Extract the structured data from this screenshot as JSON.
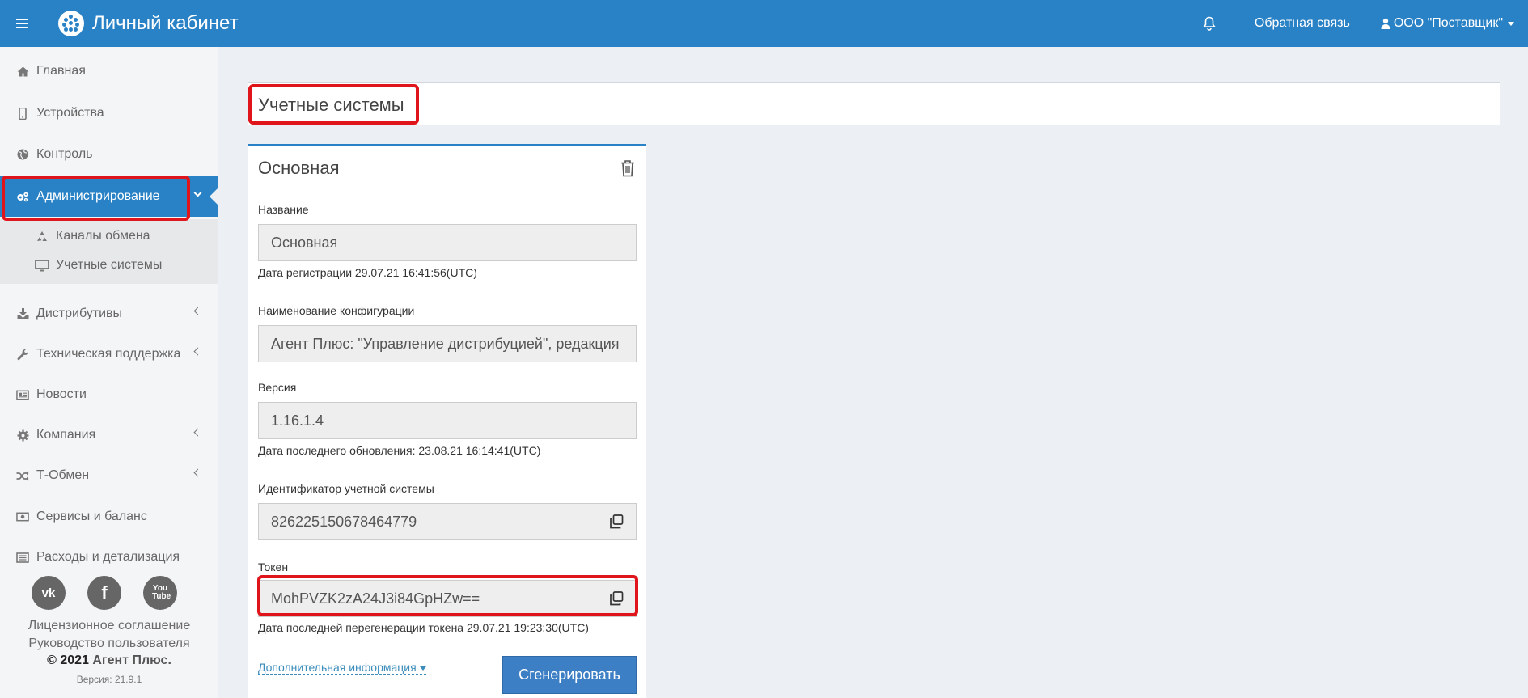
{
  "header": {
    "app_title": "Личный кабинет",
    "feedback": "Обратная связь",
    "user": "ООО \"Поставщик\"",
    "bell_icon": "bell-icon",
    "menu_icon": "hamburger-icon",
    "user_icon": "user-icon"
  },
  "sidebar": {
    "items": [
      {
        "label": "Главная",
        "icon": "home-icon"
      },
      {
        "label": "Устройства",
        "icon": "mobile-icon"
      },
      {
        "label": "Контроль",
        "icon": "globe-icon"
      },
      {
        "label": "Администрирование",
        "icon": "cogs-icon"
      },
      {
        "label": "Дистрибутивы",
        "icon": "download-icon"
      },
      {
        "label": "Техническая поддержка",
        "icon": "wrench-icon"
      },
      {
        "label": "Новости",
        "icon": "newspaper-icon"
      },
      {
        "label": "Компания",
        "icon": "gear-icon"
      },
      {
        "label": "Т-Обмен",
        "icon": "random-icon"
      },
      {
        "label": "Сервисы и баланс",
        "icon": "money-icon"
      },
      {
        "label": "Расходы и детализация",
        "icon": "list-icon"
      }
    ],
    "subitems": [
      {
        "label": "Каналы обмена",
        "icon": "recycle-icon"
      },
      {
        "label": "Учетные системы",
        "icon": "desktop-icon"
      }
    ],
    "social": [
      {
        "label": "vk",
        "icon": "vk-icon"
      },
      {
        "label": "f",
        "icon": "facebook-icon"
      },
      {
        "label": "You Tube",
        "icon": "youtube-icon"
      }
    ],
    "footer": {
      "license": "Лицензионное соглашение",
      "manual": "Руководство пользователя",
      "copyright": "© 2021",
      "company": "Агент Плюс.",
      "version": "Версия: 21.9.1"
    }
  },
  "main": {
    "page_title": "Учетные системы",
    "card": {
      "title": "Основная",
      "name_label": "Название",
      "name_value": "Основная",
      "reg_date": "Дата регистрации 29.07.21 16:41:56(UTC)",
      "config_label": "Наименование конфигурации",
      "config_value": "Агент Плюс: \"Управление дистрибуцией\", редакция",
      "version_label": "Версия",
      "version_value": "1.16.1.4",
      "update_date": "Дата последнего обновления: 23.08.21 16:14:41(UTC)",
      "id_label": "Идентификатор учетной системы",
      "id_value": "826225150678464779",
      "token_label": "Токен",
      "token_value": "MohPVZK2zA24J3i84GpHZw==",
      "token_date": "Дата последней перегенерации токена 29.07.21 19:23:30(UTC)",
      "more_info": "Дополнительная информация",
      "generate_button": "Сгенерировать"
    }
  },
  "colors": {
    "header_bg": "#2a82c6",
    "highlight": "#e0141b",
    "button_bg": "#3c7fc4"
  }
}
